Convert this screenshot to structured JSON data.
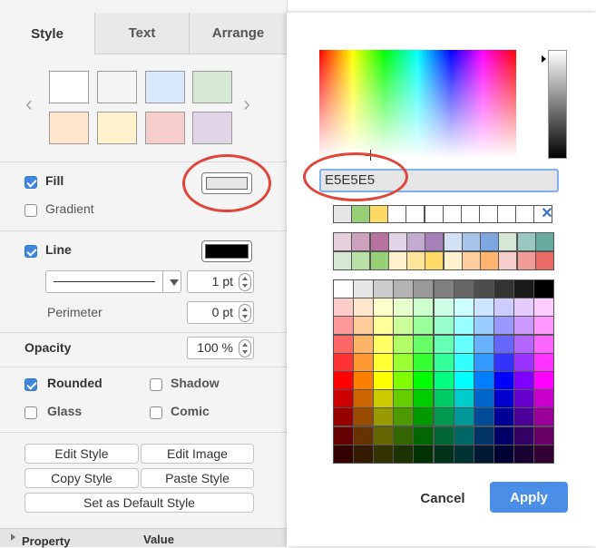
{
  "tabs": [
    "Style",
    "Text",
    "Arrange"
  ],
  "quick_swatches": [
    "#ffffff",
    "#f5f5f5",
    "#dae8fc",
    "#d5e8d4",
    "#ffe6cc",
    "#fff2cc",
    "#f8cecc",
    "#e1d5e7"
  ],
  "fill": {
    "label": "Fill",
    "checked": true,
    "color": "#e5e5e5"
  },
  "gradient": {
    "label": "Gradient",
    "checked": false
  },
  "line": {
    "label": "Line",
    "checked": true,
    "color": "#000000",
    "width": "1 pt"
  },
  "perimeter": {
    "label": "Perimeter",
    "value": "0 pt"
  },
  "opacity": {
    "label": "Opacity",
    "value": "100 %"
  },
  "options": {
    "rounded": {
      "label": "Rounded",
      "checked": true
    },
    "shadow": {
      "label": "Shadow",
      "checked": false
    },
    "glass": {
      "label": "Glass",
      "checked": false
    },
    "comic": {
      "label": "Comic",
      "checked": false
    }
  },
  "buttons": {
    "edit_style": "Edit Style",
    "edit_image": "Edit Image",
    "copy_style": "Copy Style",
    "paste_style": "Paste Style",
    "set_default": "Set as Default Style"
  },
  "table": {
    "property": "Property",
    "value": "Value"
  },
  "dialog": {
    "hex_value": "E5E5E5",
    "cancel": "Cancel",
    "apply": "Apply",
    "recent_colors": [
      "#e5e5e5",
      "#97d077",
      "#ffd966",
      "#ffffff",
      "#ffffff",
      "#ffffff",
      "#ffffff",
      "#ffffff",
      "#ffffff",
      "#ffffff",
      "#ffffff",
      "#ffffff"
    ],
    "preset_rows": [
      [
        "#e6d0de",
        "#cda2be",
        "#b5739d",
        "#e1d5e7",
        "#c3abd0",
        "#a680b8",
        "#d4e1f5",
        "#a9c4eb",
        "#7ea6e0",
        "#d5e8d4",
        "#9ac7bf",
        "#67ab9f"
      ],
      [
        "#d5e8d4",
        "#b9e0a5",
        "#97d077",
        "#fff2cc",
        "#ffe599",
        "#ffd966",
        "#fff2cc",
        "#ffce9f",
        "#ffb570",
        "#f8cecc",
        "#f19c99",
        "#ea6b66"
      ]
    ],
    "grid_rows": [
      [
        "#ffffff",
        "#e5e5e5",
        "#cccccc",
        "#b3b3b3",
        "#999999",
        "#808080",
        "#666666",
        "#4d4d4d",
        "#333333",
        "#1a1a1a",
        "#000000"
      ],
      [
        "#ffcccc",
        "#ffe6cc",
        "#ffffcc",
        "#e6ffcc",
        "#ccffcc",
        "#ccffe6",
        "#ccffff",
        "#cce5ff",
        "#ccccff",
        "#e5ccff",
        "#ffccff"
      ],
      [
        "#ff9999",
        "#ffcc99",
        "#ffff99",
        "#ccff99",
        "#99ff99",
        "#99ffcc",
        "#99ffff",
        "#99ccff",
        "#9999ff",
        "#cc99ff",
        "#ff99ff"
      ],
      [
        "#ff6666",
        "#ffb366",
        "#ffff66",
        "#b3ff66",
        "#66ff66",
        "#66ffb3",
        "#66ffff",
        "#66b2ff",
        "#6666ff",
        "#b266ff",
        "#ff66ff"
      ],
      [
        "#ff3333",
        "#ff9933",
        "#ffff33",
        "#99ff33",
        "#33ff33",
        "#33ff99",
        "#33ffff",
        "#3399ff",
        "#3333ff",
        "#9933ff",
        "#ff33ff"
      ],
      [
        "#ff0000",
        "#ff8000",
        "#ffff00",
        "#80ff00",
        "#00ff00",
        "#00ff80",
        "#00ffff",
        "#007fff",
        "#0000ff",
        "#7f00ff",
        "#ff00ff"
      ],
      [
        "#cc0000",
        "#cc6600",
        "#cccc00",
        "#66cc00",
        "#00cc00",
        "#00cc66",
        "#00cccc",
        "#0066cc",
        "#0000cc",
        "#6600cc",
        "#cc00cc"
      ],
      [
        "#990000",
        "#994c00",
        "#999900",
        "#4d9900",
        "#009900",
        "#00994d",
        "#009999",
        "#004c99",
        "#000099",
        "#4c0099",
        "#990099"
      ],
      [
        "#660000",
        "#663300",
        "#666600",
        "#336600",
        "#006600",
        "#006633",
        "#006666",
        "#003366",
        "#000066",
        "#330066",
        "#660066"
      ],
      [
        "#330000",
        "#331a00",
        "#333300",
        "#1a3300",
        "#003300",
        "#00331a",
        "#003333",
        "#001933",
        "#000033",
        "#190033",
        "#330033"
      ]
    ]
  }
}
